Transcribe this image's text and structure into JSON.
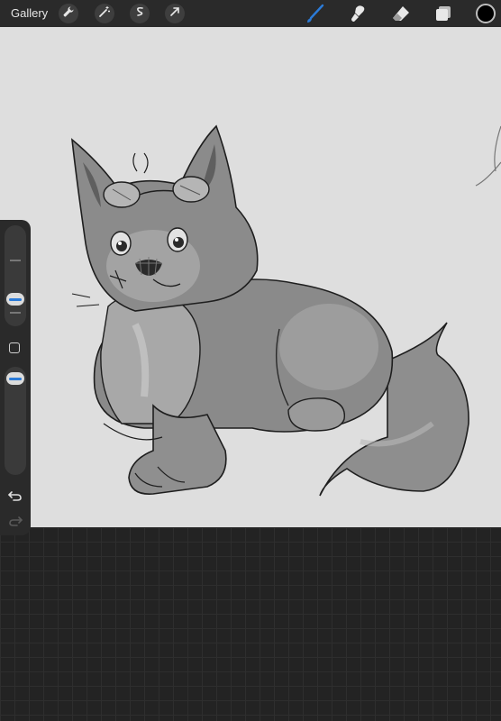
{
  "topbar": {
    "gallery_label": "Gallery",
    "left_tools": [
      "wrench-icon",
      "magic-wand-icon",
      "selection-icon",
      "transform-icon"
    ],
    "right_tools": [
      "brush-icon",
      "smudge-icon",
      "eraser-icon",
      "layers-icon"
    ],
    "active_tool": "brush-icon",
    "accent_color": "#2b7bd8",
    "current_color": "#000000"
  },
  "sidebar": {
    "brush_size_level": 0.3,
    "opacity_level": 0.96,
    "controls": [
      "brush-size-slider",
      "modify-button",
      "opacity-slider",
      "undo-button",
      "redo-button"
    ]
  },
  "canvas": {
    "background": "#dedede",
    "artwork": "sketch"
  }
}
